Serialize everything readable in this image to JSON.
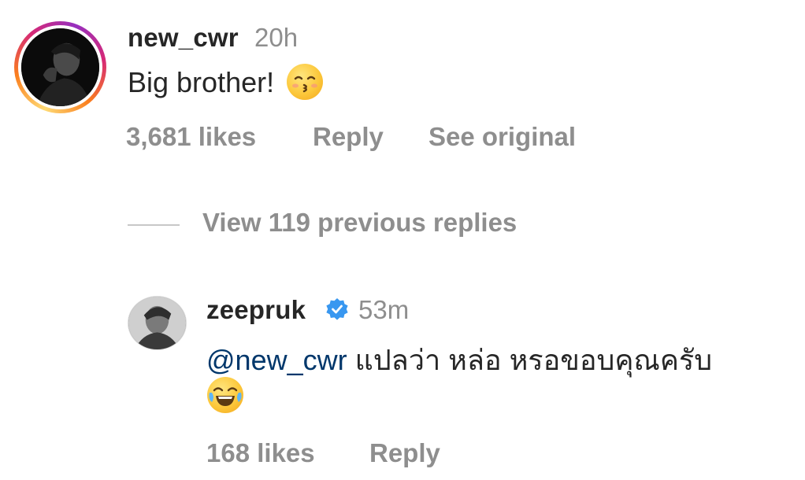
{
  "main_comment": {
    "username": "new_cwr",
    "time": "20h",
    "text": "Big brother!",
    "emoji": "kissing-face-emoji",
    "likes": "3,681 likes",
    "reply_label": "Reply",
    "see_original_label": "See original"
  },
  "replies_toggle": {
    "label": "View 119 previous replies"
  },
  "reply_comment": {
    "username": "zeepruk",
    "time": "53m",
    "mention": "@new_cwr",
    "text": "แปลว่า หล่อ หรอขอบคุณครับ",
    "emoji": "face-with-tears-of-joy-emoji",
    "likes": "168 likes",
    "reply_label": "Reply"
  },
  "colors": {
    "text": "#262626",
    "secondary": "#8e8e8e",
    "mention": "#00376b",
    "verified": "#3897f0"
  }
}
